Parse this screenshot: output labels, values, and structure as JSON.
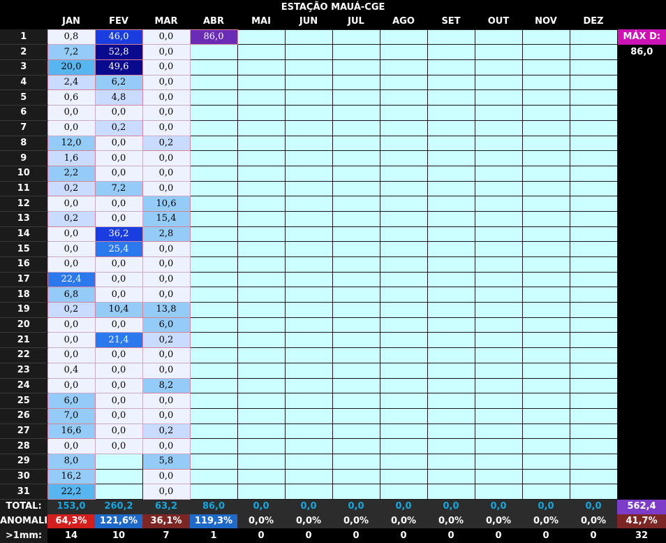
{
  "title": "ESTAÇÃO MAUÁ-CGE",
  "months": [
    "JAN",
    "FEV",
    "MAR",
    "ABR",
    "MAI",
    "JUN",
    "JUL",
    "AGO",
    "SET",
    "OUT",
    "NOV",
    "DEZ"
  ],
  "max_daily": {
    "label": "MÁX D:",
    "value": "86,0"
  },
  "rows": [
    {
      "day": "1",
      "values": [
        "0,8",
        "46,0",
        "0,0",
        "86,0"
      ],
      "levels": [
        0,
        5,
        0,
        7
      ]
    },
    {
      "day": "2",
      "values": [
        "7,2",
        "52,8",
        "0,0"
      ],
      "levels": [
        2,
        6,
        0
      ]
    },
    {
      "day": "3",
      "values": [
        "20,0",
        "49,6",
        "0,0"
      ],
      "levels": [
        3,
        6,
        0
      ]
    },
    {
      "day": "4",
      "values": [
        "2,4",
        "6,2",
        "0,0"
      ],
      "levels": [
        1,
        2,
        0
      ]
    },
    {
      "day": "5",
      "values": [
        "0,6",
        "4,8",
        "0,0"
      ],
      "levels": [
        0,
        1,
        0
      ]
    },
    {
      "day": "6",
      "values": [
        "0,0",
        "0,0",
        "0,0"
      ],
      "levels": [
        0,
        0,
        0
      ]
    },
    {
      "day": "7",
      "values": [
        "0,0",
        "0,2",
        "0,0"
      ],
      "levels": [
        0,
        1,
        0
      ]
    },
    {
      "day": "8",
      "values": [
        "12,0",
        "0,0",
        "0,2"
      ],
      "levels": [
        2,
        0,
        1
      ]
    },
    {
      "day": "9",
      "values": [
        "1,6",
        "0,0",
        "0,0"
      ],
      "levels": [
        1,
        0,
        0
      ]
    },
    {
      "day": "10",
      "values": [
        "2,2",
        "0,0",
        "0,0"
      ],
      "levels": [
        2,
        0,
        0
      ]
    },
    {
      "day": "11",
      "values": [
        "0,2",
        "7,2",
        "0,0"
      ],
      "levels": [
        1,
        2,
        0
      ]
    },
    {
      "day": "12",
      "values": [
        "0,0",
        "0,0",
        "10,6"
      ],
      "levels": [
        0,
        0,
        2
      ]
    },
    {
      "day": "13",
      "values": [
        "0,2",
        "0,0",
        "15,4"
      ],
      "levels": [
        1,
        0,
        2
      ]
    },
    {
      "day": "14",
      "values": [
        "0,0",
        "36,2",
        "2,8"
      ],
      "levels": [
        0,
        5,
        2
      ]
    },
    {
      "day": "15",
      "values": [
        "0,0",
        "25,4",
        "0,0"
      ],
      "levels": [
        0,
        4,
        0
      ]
    },
    {
      "day": "16",
      "values": [
        "0,0",
        "0,0",
        "0,0"
      ],
      "levels": [
        0,
        0,
        0
      ]
    },
    {
      "day": "17",
      "values": [
        "22,4",
        "0,0",
        "0,0"
      ],
      "levels": [
        4,
        0,
        0
      ]
    },
    {
      "day": "18",
      "values": [
        "6,8",
        "0,0",
        "0,0"
      ],
      "levels": [
        2,
        0,
        0
      ]
    },
    {
      "day": "19",
      "values": [
        "0,2",
        "10,4",
        "13,8"
      ],
      "levels": [
        1,
        2,
        2
      ]
    },
    {
      "day": "20",
      "values": [
        "0,0",
        "0,0",
        "6,0"
      ],
      "levels": [
        0,
        0,
        2
      ]
    },
    {
      "day": "21",
      "values": [
        "0,0",
        "21,4",
        "0,2"
      ],
      "levels": [
        0,
        4,
        1
      ]
    },
    {
      "day": "22",
      "values": [
        "0,0",
        "0,0",
        "0,0"
      ],
      "levels": [
        0,
        0,
        0
      ]
    },
    {
      "day": "23",
      "values": [
        "0,4",
        "0,0",
        "0,0"
      ],
      "levels": [
        0,
        0,
        0
      ]
    },
    {
      "day": "24",
      "values": [
        "0,0",
        "0,0",
        "8,2"
      ],
      "levels": [
        0,
        0,
        2
      ]
    },
    {
      "day": "25",
      "values": [
        "6,0",
        "0,0",
        "0,0"
      ],
      "levels": [
        2,
        0,
        0
      ]
    },
    {
      "day": "26",
      "values": [
        "7,0",
        "0,0",
        "0,0"
      ],
      "levels": [
        2,
        0,
        0
      ]
    },
    {
      "day": "27",
      "values": [
        "16,6",
        "0,0",
        "0,2"
      ],
      "levels": [
        2,
        0,
        1
      ]
    },
    {
      "day": "28",
      "values": [
        "0,0",
        "0,0",
        "0,0"
      ],
      "levels": [
        0,
        0,
        0
      ]
    },
    {
      "day": "29",
      "values": [
        "8,0",
        "",
        "5,8"
      ],
      "levels": [
        2,
        -1,
        2
      ]
    },
    {
      "day": "30",
      "values": [
        "16,2",
        "",
        "0,0"
      ],
      "levels": [
        2,
        -1,
        0
      ]
    },
    {
      "day": "31",
      "values": [
        "22,2",
        "",
        "0,0"
      ],
      "levels": [
        3,
        -1,
        0
      ]
    }
  ],
  "totals": {
    "label": "TOTAL:",
    "values": [
      "153,0",
      "260,2",
      "63,2",
      "86,0",
      "0,0",
      "0,0",
      "0,0",
      "0,0",
      "0,0",
      "0,0",
      "0,0",
      "0,0"
    ],
    "sum": "562,4"
  },
  "anomaly": {
    "label": "ANOMALIA",
    "values": [
      "64,3%",
      "121,6%",
      "36,1%",
      "119,3%",
      "0,0%",
      "0,0%",
      "0,0%",
      "0,0%",
      "0,0%",
      "0,0%",
      "0,0%",
      "0,0%"
    ],
    "styles": [
      "hi",
      "bl",
      "br",
      "bl",
      "",
      "",
      "",
      "",
      "",
      "",
      "",
      ""
    ],
    "sum": "41,7%"
  },
  "count": {
    "label": ">1mm:",
    "values": [
      "14",
      "10",
      "7",
      "1",
      "0",
      "0",
      "0",
      "0",
      "0",
      "0",
      "0",
      "0"
    ],
    "sum": "32"
  }
}
